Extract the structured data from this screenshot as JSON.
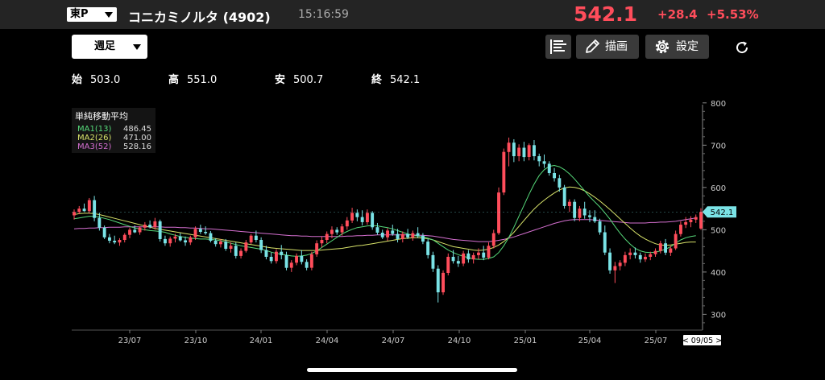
{
  "header": {
    "market": "東P",
    "stock_name": "コニカミノルタ (4902)",
    "time": "15:16:59",
    "price": "542.1",
    "change": "+28.4",
    "change_pct": "+5.53%"
  },
  "toolbar": {
    "period": "週足",
    "draw_label": "描画",
    "settings_label": "設定"
  },
  "ohlc": {
    "open_label": "始",
    "open": "503.0",
    "high_label": "高",
    "high": "551.0",
    "low_label": "安",
    "low": "500.7",
    "close_label": "終",
    "close": "542.1"
  },
  "legend": {
    "title": "単純移動平均",
    "ma1_label": "MA1(13)",
    "ma1_value": "486.45",
    "ma2_label": "MA2(26)",
    "ma2_value": "471.00",
    "ma3_label": "MA3(52)",
    "ma3_value": "528.16"
  },
  "colors": {
    "up": "#ff4d5b",
    "down": "#7ae3e6",
    "ma1": "#56d97a",
    "ma2": "#d8e36a",
    "ma3": "#d56fd0",
    "price_tag": "#7ae3e6"
  },
  "chart_data": {
    "type": "candlestick",
    "ylim": [
      270,
      810
    ],
    "y_ticks": [
      "800",
      "700",
      "600",
      "500",
      "400",
      "300"
    ],
    "x_ticks": [
      "23/07",
      "23/10",
      "24/01",
      "24/04",
      "24/07",
      "24/10",
      "25/01",
      "25/04",
      "25/07"
    ],
    "last_price_label": "542.1",
    "cursor_date_label": "< 09/05 >",
    "candles": [
      [
        534,
        548,
        524,
        542
      ],
      [
        542,
        556,
        537,
        550
      ],
      [
        550,
        562,
        543,
        544
      ],
      [
        544,
        575,
        538,
        570
      ],
      [
        570,
        580,
        520,
        528
      ],
      [
        528,
        540,
        498,
        505
      ],
      [
        505,
        510,
        478,
        482
      ],
      [
        482,
        490,
        468,
        474
      ],
      [
        474,
        486,
        466,
        470
      ],
      [
        470,
        480,
        462,
        476
      ],
      [
        476,
        492,
        470,
        488
      ],
      [
        488,
        505,
        480,
        500
      ],
      [
        500,
        510,
        492,
        494
      ],
      [
        494,
        508,
        488,
        505
      ],
      [
        505,
        518,
        498,
        512
      ],
      [
        512,
        522,
        503,
        506
      ],
      [
        506,
        528,
        500,
        520
      ],
      [
        520,
        524,
        472,
        478
      ],
      [
        478,
        486,
        462,
        468
      ],
      [
        468,
        484,
        460,
        479
      ],
      [
        479,
        490,
        470,
        484
      ],
      [
        484,
        492,
        472,
        475
      ],
      [
        475,
        484,
        462,
        470
      ],
      [
        470,
        486,
        464,
        482
      ],
      [
        482,
        508,
        476,
        502
      ],
      [
        502,
        512,
        490,
        495
      ],
      [
        495,
        508,
        488,
        492
      ],
      [
        492,
        497,
        470,
        474
      ],
      [
        474,
        480,
        460,
        466
      ],
      [
        466,
        478,
        458,
        472
      ],
      [
        472,
        478,
        450,
        455
      ],
      [
        455,
        470,
        446,
        462
      ],
      [
        462,
        470,
        432,
        438
      ],
      [
        438,
        456,
        432,
        450
      ],
      [
        450,
        476,
        446,
        470
      ],
      [
        470,
        490,
        466,
        486
      ],
      [
        486,
        498,
        470,
        476
      ],
      [
        476,
        482,
        445,
        452
      ],
      [
        452,
        462,
        430,
        436
      ],
      [
        436,
        446,
        420,
        426
      ],
      [
        426,
        454,
        420,
        448
      ],
      [
        448,
        464,
        430,
        440
      ],
      [
        440,
        448,
        404,
        410
      ],
      [
        410,
        428,
        400,
        422
      ],
      [
        422,
        444,
        416,
        438
      ],
      [
        438,
        452,
        418,
        424
      ],
      [
        424,
        430,
        404,
        410
      ],
      [
        410,
        448,
        404,
        442
      ],
      [
        442,
        475,
        436,
        468
      ],
      [
        468,
        484,
        458,
        476
      ],
      [
        476,
        496,
        468,
        490
      ],
      [
        490,
        508,
        480,
        500
      ],
      [
        500,
        506,
        488,
        494
      ],
      [
        494,
        514,
        486,
        508
      ],
      [
        508,
        530,
        500,
        522
      ],
      [
        522,
        552,
        516,
        540
      ],
      [
        540,
        548,
        520,
        530
      ],
      [
        530,
        546,
        510,
        518
      ],
      [
        518,
        548,
        512,
        540
      ],
      [
        540,
        544,
        500,
        506
      ],
      [
        506,
        516,
        488,
        493
      ],
      [
        493,
        500,
        478,
        482
      ],
      [
        482,
        504,
        474,
        498
      ],
      [
        498,
        512,
        486,
        490
      ],
      [
        490,
        502,
        470,
        478
      ],
      [
        478,
        496,
        470,
        490
      ],
      [
        490,
        502,
        478,
        482
      ],
      [
        482,
        498,
        474,
        492
      ],
      [
        492,
        506,
        480,
        486
      ],
      [
        486,
        492,
        466,
        472
      ],
      [
        472,
        478,
        432,
        440
      ],
      [
        440,
        448,
        400,
        408
      ],
      [
        408,
        416,
        328,
        352
      ],
      [
        352,
        404,
        346,
        398
      ],
      [
        398,
        444,
        392,
        436
      ],
      [
        436,
        452,
        420,
        426
      ],
      [
        426,
        438,
        412,
        420
      ],
      [
        420,
        450,
        414,
        444
      ],
      [
        444,
        452,
        422,
        430
      ],
      [
        430,
        446,
        420,
        440
      ],
      [
        440,
        456,
        430,
        446
      ],
      [
        446,
        462,
        428,
        434
      ],
      [
        434,
        470,
        430,
        462
      ],
      [
        462,
        500,
        456,
        492
      ],
      [
        492,
        600,
        488,
        588
      ],
      [
        588,
        692,
        582,
        684
      ],
      [
        684,
        718,
        650,
        706
      ],
      [
        706,
        714,
        660,
        674
      ],
      [
        674,
        702,
        662,
        694
      ],
      [
        694,
        708,
        662,
        672
      ],
      [
        672,
        704,
        664,
        700
      ],
      [
        700,
        712,
        664,
        674
      ],
      [
        674,
        680,
        650,
        662
      ],
      [
        662,
        678,
        646,
        656
      ],
      [
        656,
        662,
        628,
        634
      ],
      [
        634,
        646,
        614,
        622
      ],
      [
        622,
        630,
        590,
        600
      ],
      [
        600,
        606,
        550,
        556
      ],
      [
        556,
        572,
        542,
        566
      ],
      [
        566,
        572,
        520,
        528
      ],
      [
        528,
        556,
        520,
        550
      ],
      [
        550,
        566,
        526,
        534
      ],
      [
        534,
        546,
        518,
        530
      ],
      [
        530,
        546,
        516,
        520
      ],
      [
        520,
        526,
        488,
        494
      ],
      [
        494,
        510,
        440,
        446
      ],
      [
        446,
        456,
        396,
        404
      ],
      [
        404,
        424,
        374,
        414
      ],
      [
        414,
        428,
        404,
        422
      ],
      [
        422,
        448,
        414,
        440
      ],
      [
        440,
        456,
        430,
        446
      ],
      [
        446,
        458,
        432,
        440
      ],
      [
        440,
        446,
        422,
        430
      ],
      [
        430,
        444,
        424,
        436
      ],
      [
        436,
        448,
        428,
        442
      ],
      [
        442,
        456,
        436,
        450
      ],
      [
        450,
        474,
        444,
        468
      ],
      [
        468,
        478,
        440,
        446
      ],
      [
        446,
        462,
        438,
        456
      ],
      [
        456,
        498,
        452,
        490
      ],
      [
        490,
        520,
        484,
        512
      ],
      [
        512,
        530,
        504,
        518
      ],
      [
        518,
        532,
        506,
        524
      ],
      [
        524,
        536,
        516,
        530
      ],
      [
        503,
        551,
        500,
        542
      ]
    ],
    "ma1": [
      526,
      528,
      530,
      532,
      532,
      530,
      527,
      524,
      520,
      516,
      512,
      508,
      504,
      502,
      500,
      498,
      497,
      496,
      494,
      490,
      487,
      484,
      482,
      480,
      479,
      478,
      478,
      477,
      476,
      474,
      471,
      468,
      465,
      462,
      460,
      458,
      456,
      454,
      451,
      447,
      444,
      442,
      440,
      438,
      437,
      438,
      440,
      444,
      450,
      458,
      466,
      474,
      482,
      490,
      496,
      501,
      505,
      507,
      509,
      510,
      509,
      507,
      505,
      502,
      498,
      494,
      490,
      487,
      485,
      483,
      480,
      476,
      468,
      460,
      452,
      446,
      441,
      437,
      434,
      431,
      430,
      430,
      432,
      436,
      446,
      462,
      482,
      506,
      532,
      558,
      584,
      608,
      628,
      642,
      650,
      652,
      649,
      642,
      632,
      620,
      606,
      592,
      578,
      566,
      554,
      540,
      525,
      508,
      492,
      478,
      466,
      456,
      450,
      447,
      446,
      447,
      450,
      454,
      460,
      468,
      476,
      481,
      484,
      486
    ],
    "ma2": [
      536,
      538,
      539,
      539,
      538,
      536,
      533,
      530,
      527,
      524,
      521,
      518,
      515,
      512,
      509,
      506,
      503,
      501,
      499,
      497,
      495,
      493,
      491,
      489,
      487,
      485,
      483,
      481,
      479,
      477,
      475,
      473,
      471,
      469,
      467,
      465,
      463,
      461,
      459,
      457,
      456,
      455,
      454,
      453,
      452,
      451,
      451,
      451,
      451,
      452,
      453,
      454,
      455,
      456,
      458,
      460,
      462,
      463,
      465,
      467,
      469,
      471,
      473,
      475,
      477,
      479,
      480,
      481,
      481,
      480,
      479,
      476,
      472,
      468,
      464,
      460,
      458,
      456,
      454,
      452,
      451,
      452,
      454,
      458,
      464,
      472,
      482,
      494,
      508,
      522,
      536,
      549,
      560,
      570,
      579,
      587,
      594,
      599,
      601,
      600,
      597,
      592,
      585,
      577,
      568,
      558,
      548,
      537,
      526,
      515,
      504,
      494,
      485,
      478,
      472,
      467,
      464,
      463,
      464,
      466,
      468,
      470,
      471,
      471
    ],
    "ma3": [
      502,
      503,
      503,
      504,
      504,
      505,
      505,
      506,
      506,
      506,
      507,
      507,
      507,
      507,
      507,
      507,
      507,
      507,
      506,
      506,
      506,
      505,
      505,
      504,
      504,
      503,
      502,
      502,
      501,
      500,
      499,
      498,
      497,
      496,
      495,
      494,
      493,
      492,
      491,
      490,
      489,
      488,
      487,
      486,
      486,
      485,
      485,
      484,
      484,
      484,
      484,
      484,
      484,
      484,
      485,
      485,
      486,
      486,
      487,
      487,
      488,
      488,
      488,
      488,
      488,
      488,
      488,
      488,
      487,
      487,
      486,
      485,
      483,
      481,
      479,
      477,
      476,
      475,
      474,
      473,
      472,
      472,
      472,
      473,
      475,
      477,
      480,
      483,
      487,
      491,
      495,
      499,
      503,
      507,
      511,
      515,
      518,
      521,
      523,
      524,
      524,
      524,
      524,
      523,
      522,
      521,
      520,
      519,
      518,
      517,
      516,
      516,
      516,
      516,
      517,
      517,
      518,
      518,
      519,
      520,
      522,
      524,
      526,
      528
    ]
  }
}
